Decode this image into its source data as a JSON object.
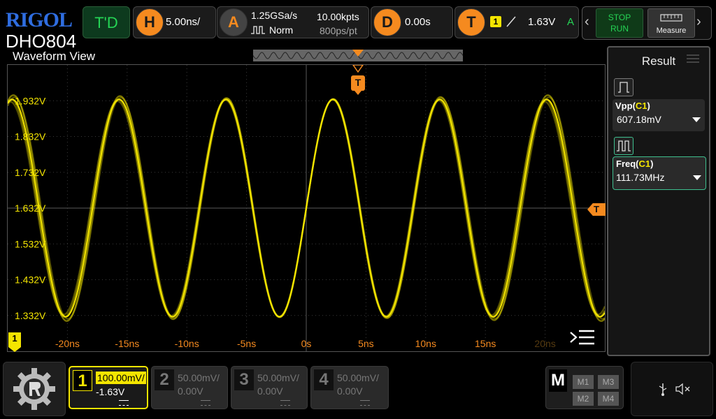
{
  "brand": {
    "logo": "RIGOL",
    "model": "DHO804"
  },
  "topbar": {
    "td_label": "T'D",
    "horizontal": {
      "icon_letter": "H",
      "timebase": "5.00ns/"
    },
    "acquire": {
      "icon_letter": "A",
      "sample_rate": "1.25GSa/s",
      "mode": "Norm",
      "memory": "10.00kpts",
      "resolution": "800ps/pt"
    },
    "delay": {
      "icon_letter": "D",
      "value": "0.00s"
    },
    "trigger": {
      "icon_letter": "T",
      "source": "1",
      "level": "1.63V",
      "mode": "A"
    },
    "run": {
      "stop": "STOP",
      "run": "RUN"
    },
    "measure_label": "Measure"
  },
  "waveform": {
    "title": "Waveform View",
    "color": "#f4e500",
    "y_labels": [
      "1.932V",
      "1.832V",
      "1.732V",
      "1.632V",
      "1.532V",
      "1.432V",
      "1.332V"
    ],
    "x_labels": [
      "-20ns",
      "-15ns",
      "-10ns",
      "-5ns",
      "0s",
      "5ns",
      "10ns",
      "15ns",
      "20ns"
    ],
    "trigger_marker": "T",
    "channel_marker": "1",
    "signal": {
      "type": "sine",
      "frequency_MHz": 111.73,
      "vpp_mV": 607.18,
      "offset_V": 1.632
    },
    "x_range_ns": [
      -25,
      25
    ],
    "y_range_V": [
      1.232,
      2.032
    ]
  },
  "result": {
    "title": "Result",
    "items": [
      {
        "name": "Vpp",
        "src": "C1",
        "value": "607.18mV"
      },
      {
        "name": "Freq",
        "src": "C1",
        "value": "111.73MHz"
      }
    ]
  },
  "channels": [
    {
      "num": "1",
      "scale": "100.00mV/",
      "offset": "-1.63V",
      "active": true
    },
    {
      "num": "2",
      "scale": "50.00mV/",
      "offset": "0.00V",
      "active": false
    },
    {
      "num": "3",
      "scale": "50.00mV/",
      "offset": "0.00V",
      "active": false
    },
    {
      "num": "4",
      "scale": "50.00mV/",
      "offset": "0.00V",
      "active": false
    }
  ],
  "math": {
    "label": "M",
    "items": [
      "M1",
      "M3",
      "M2",
      "M4"
    ]
  }
}
